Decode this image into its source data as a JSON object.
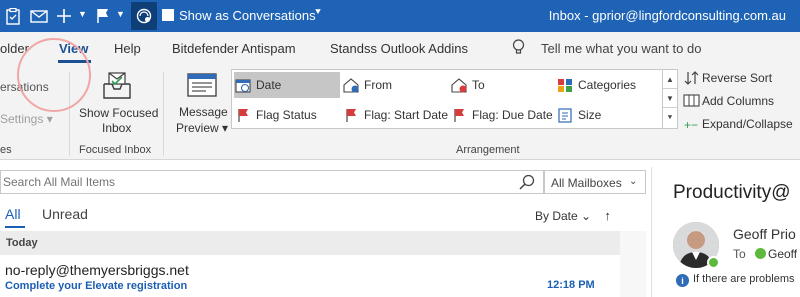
{
  "window": {
    "title": "Inbox - gprior@lingfordconsulting.com.au"
  },
  "quick_access": {
    "show_as_conversations_label": "Show as Conversations",
    "icons": [
      "clipboard-icon",
      "mail-icon",
      "plus-icon",
      "flag-icon",
      "sync-icon"
    ]
  },
  "tabs": [
    {
      "label": "older"
    },
    {
      "label": "View"
    },
    {
      "label": "Help"
    },
    {
      "label": "Bitdefender Antispam"
    },
    {
      "label": "Standss Outlook Addins"
    }
  ],
  "tell_me": {
    "placeholder": "Tell me what you want to do"
  },
  "ribbon": {
    "conversations_label": "ersations",
    "settings_label": "Settings",
    "group_left_label": "es",
    "show_focused_inbox_line1": "Show Focused",
    "show_focused_inbox_line2": "Inbox",
    "focused_inbox_group_label": "Focused Inbox",
    "message_preview_line1": "Message",
    "message_preview_line2": "Preview",
    "arrangement": {
      "items": [
        {
          "label": "Date"
        },
        {
          "label": "From"
        },
        {
          "label": "To"
        },
        {
          "label": "Categories"
        },
        {
          "label": "Flag Status"
        },
        {
          "label": "Flag: Start Date"
        },
        {
          "label": "Flag: Due Date"
        },
        {
          "label": "Size"
        }
      ],
      "group_label": "Arrangement"
    },
    "reverse_sort_label": "Reverse Sort",
    "add_columns_label": "Add Columns",
    "expand_collapse_label": "Expand/Collapse"
  },
  "search": {
    "placeholder": "Search All Mail Items",
    "scope": "All Mailboxes"
  },
  "list": {
    "filter_all": "All",
    "filter_unread": "Unread",
    "sort_label": "By Date",
    "group_today": "Today",
    "emails": [
      {
        "sender": "no-reply@themyersbriggs.net",
        "subject": "Complete your Elevate registration",
        "time": "12:18 PM"
      }
    ]
  },
  "reading_pane": {
    "title": "Productivity@",
    "sender": "Geoff Prio",
    "to_label": "To",
    "recipient": "Geoff",
    "info": "If there are problems"
  },
  "colors": {
    "title_bar": "#1e63b5",
    "accent": "#1b5fb4",
    "ribbon_bg": "#f3f3f3",
    "highlight_circle": "#f0a6a6"
  }
}
